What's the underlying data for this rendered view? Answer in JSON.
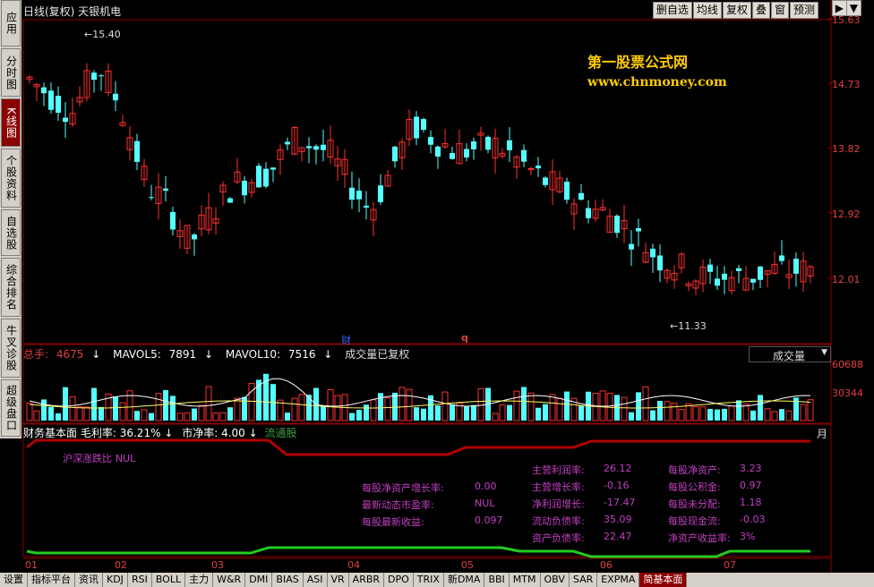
{
  "sidebar": {
    "tabs": [
      {
        "label": "应用",
        "active": false
      },
      {
        "label": "分时图",
        "active": false
      },
      {
        "label": "K线图",
        "active": true
      },
      {
        "label": "个股资料",
        "active": false
      },
      {
        "label": "自选股",
        "active": false
      },
      {
        "label": "综合排名",
        "active": false
      },
      {
        "label": "牛叉诊股",
        "active": false
      },
      {
        "label": "超级盘口",
        "active": false
      }
    ]
  },
  "header": {
    "title": "日线(复权)  天银机电",
    "buttons": [
      "删自选",
      "均线",
      "复权",
      "叠",
      "窗",
      "预测"
    ],
    "arrow_glyph": "▶",
    "dropdown_glyph": "▼"
  },
  "price_axis": [
    "15.63",
    "14.73",
    "13.82",
    "12.92",
    "12.01"
  ],
  "kline": {
    "high_label": "15.40",
    "low_label": "11.33",
    "marker1": "财",
    "marker2": "q"
  },
  "watermark": {
    "line1": "第一股票公式网",
    "line2": "www.chnmoney.com"
  },
  "volume": {
    "header": {
      "total_label": "总手:",
      "total_value": "4675",
      "mavol5_label": "MAVOL5:",
      "mavol5_value": "7891",
      "mavol10_label": "MAVOL10:",
      "mavol10_value": "7516",
      "note": "成交量已复权"
    },
    "selector": "成交量",
    "axis": [
      "60688",
      "30344"
    ]
  },
  "fund": {
    "header": {
      "name": "财务基本面",
      "gross_label": "毛利率:",
      "gross_value": "36.21%",
      "ps_label": "市净率:",
      "ps_value": "4.00",
      "float_label": "流通股",
      "right_char": "月"
    },
    "index_label": "沪深涨跌比",
    "index_value": "NUL",
    "col1": [
      {
        "label": "每股净资产增长率:",
        "value": "0.00"
      },
      {
        "label": "最新动态市盈率:",
        "value": "NUL"
      },
      {
        "label": "每股最新收益:",
        "value": "0.097"
      }
    ],
    "col2": [
      {
        "label": "主营利润率:",
        "value": "26.12"
      },
      {
        "label": "主营增长率:",
        "value": "-0.16"
      },
      {
        "label": "净利润增长:",
        "value": "-17.47"
      },
      {
        "label": "流动负债率:",
        "value": "35.09"
      },
      {
        "label": "资产负债率:",
        "value": "22.47"
      }
    ],
    "col3": [
      {
        "label": "每股净资产:",
        "value": "3.23"
      },
      {
        "label": "每股公积金:",
        "value": "0.97"
      },
      {
        "label": "每股未分配:",
        "value": "1.18"
      },
      {
        "label": "每股现金流:",
        "value": "-0.03"
      },
      {
        "label": "净资产收益率:",
        "value": "3%"
      }
    ]
  },
  "x_axis": [
    "01",
    "02",
    "03",
    "04",
    "05",
    "06",
    "07"
  ],
  "bottom_tabs": [
    "设置",
    "指标平台",
    "资讯",
    "KDJ",
    "RSI",
    "BOLL",
    "主力",
    "W&R",
    "DMI",
    "BIAS",
    "ASI",
    "VR",
    "ARBR",
    "DPO",
    "TRIX",
    "新DMA",
    "BBI",
    "MTM",
    "OBV",
    "SAR",
    "EXPMA",
    "简基本面"
  ],
  "active_bottom_tab": "简基本面",
  "colors": {
    "up": "#ff3030",
    "down": "#54ffff",
    "axis": "#e04040",
    "label": "#c040c0",
    "accent_active": "#8b0000"
  }
}
